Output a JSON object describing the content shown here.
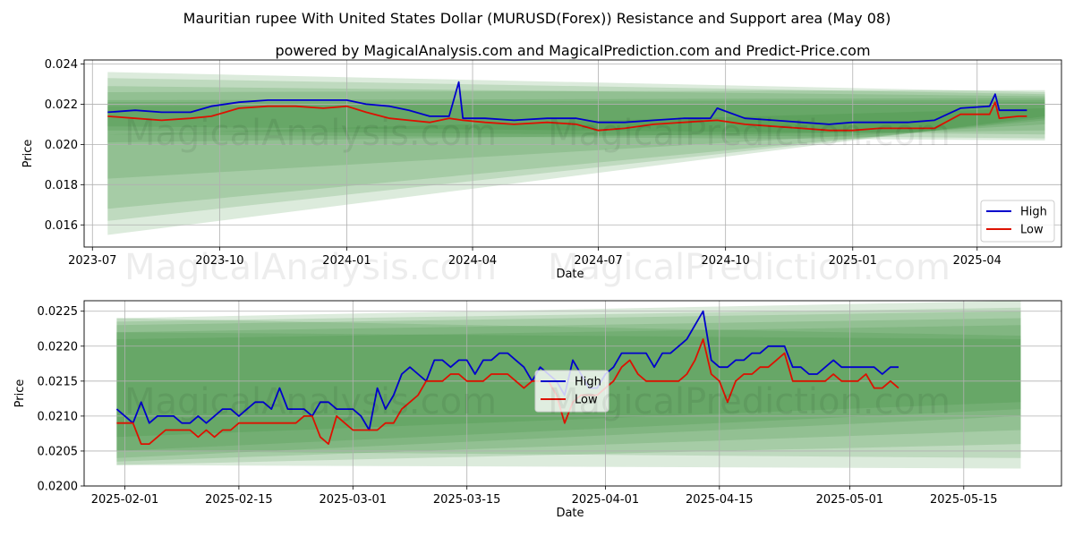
{
  "header": {
    "title": "Mauritian rupee With United States Dollar (MURUSD(Forex)) Resistance and Support area (May 08)",
    "subtitle": "powered by MagicalAnalysis.com and MagicalPrediction.com and Predict-Price.com"
  },
  "watermark": {
    "left": "MagicalAnalysis.com",
    "right": "MagicalPrediction.com"
  },
  "colors": {
    "high": "#0000cc",
    "low": "#dd1100",
    "band": "#2e8b2e",
    "grid": "#b0b0b0"
  },
  "chart_data": [
    {
      "type": "line",
      "xlabel": "Date",
      "ylabel": "Price",
      "x_range": [
        "2023-06-25",
        "2025-06-01"
      ],
      "ylim": [
        0.0149,
        0.0242
      ],
      "grid": true,
      "legend_position": "lower-right",
      "x_ticks": [
        "2023-07",
        "2023-10",
        "2024-01",
        "2024-04",
        "2024-07",
        "2024-10",
        "2025-01",
        "2025-04"
      ],
      "y_ticks": [
        "0.016",
        "0.018",
        "0.020",
        "0.022",
        "0.024"
      ],
      "bands": {
        "start": "2023-07-12",
        "end": "2025-05-20",
        "fans": [
          {
            "start": [
              0.0236,
              0.0205
            ],
            "end": [
              0.0226,
              0.0202
            ]
          },
          {
            "start": [
              0.0233,
              0.0207
            ],
            "end": [
              0.0225,
              0.0203
            ]
          },
          {
            "start": [
              0.0229,
              0.0209
            ],
            "end": [
              0.0224,
              0.0205
            ]
          },
          {
            "start": [
              0.0226,
              0.0201
            ],
            "end": [
              0.0227,
              0.0207
            ]
          },
          {
            "start": [
              0.0222,
              0.0183
            ],
            "end": [
              0.0223,
              0.021
            ]
          },
          {
            "start": [
              0.0221,
              0.0168
            ],
            "end": [
              0.0222,
              0.0212
            ]
          },
          {
            "start": [
              0.0219,
              0.0162
            ],
            "end": [
              0.0221,
              0.0213
            ]
          },
          {
            "start": [
              0.0205,
              0.0155
            ],
            "end": [
              0.0218,
              0.0214
            ]
          }
        ]
      },
      "series": [
        {
          "name": "High",
          "color": "#0000cc",
          "x": [
            "2023-07-12",
            "2023-08-01",
            "2023-08-20",
            "2023-09-10",
            "2023-09-25",
            "2023-10-15",
            "2023-11-05",
            "2023-11-25",
            "2023-12-15",
            "2024-01-01",
            "2024-01-15",
            "2024-02-01",
            "2024-02-15",
            "2024-03-01",
            "2024-03-15",
            "2024-03-22",
            "2024-03-25",
            "2024-04-10",
            "2024-05-01",
            "2024-05-25",
            "2024-06-15",
            "2024-07-01",
            "2024-07-20",
            "2024-08-10",
            "2024-09-01",
            "2024-09-20",
            "2024-09-25",
            "2024-10-15",
            "2024-11-05",
            "2024-11-25",
            "2024-12-15",
            "2025-01-01",
            "2025-01-20",
            "2025-02-10",
            "2025-03-01",
            "2025-03-20",
            "2025-04-10",
            "2025-04-14",
            "2025-04-17",
            "2025-05-01",
            "2025-05-07"
          ],
          "values": [
            0.0216,
            0.0217,
            0.0216,
            0.0216,
            0.0219,
            0.0221,
            0.0222,
            0.0222,
            0.0222,
            0.0222,
            0.022,
            0.0219,
            0.0217,
            0.0214,
            0.0214,
            0.0231,
            0.0213,
            0.0213,
            0.0212,
            0.0213,
            0.0213,
            0.0211,
            0.0211,
            0.0212,
            0.0213,
            0.0213,
            0.0218,
            0.0213,
            0.0212,
            0.0211,
            0.021,
            0.0211,
            0.0211,
            0.0211,
            0.0212,
            0.0218,
            0.0219,
            0.0225,
            0.0217,
            0.0217,
            0.0217
          ]
        },
        {
          "name": "Low",
          "color": "#dd1100",
          "x": [
            "2023-07-12",
            "2023-08-01",
            "2023-08-20",
            "2023-09-10",
            "2023-09-25",
            "2023-10-15",
            "2023-11-05",
            "2023-11-25",
            "2023-12-15",
            "2024-01-01",
            "2024-01-15",
            "2024-02-01",
            "2024-02-15",
            "2024-03-01",
            "2024-03-15",
            "2024-03-25",
            "2024-04-10",
            "2024-05-01",
            "2024-05-25",
            "2024-06-15",
            "2024-07-01",
            "2024-07-20",
            "2024-08-10",
            "2024-09-01",
            "2024-09-25",
            "2024-10-15",
            "2024-11-05",
            "2024-11-25",
            "2024-12-15",
            "2025-01-01",
            "2025-01-20",
            "2025-02-10",
            "2025-03-01",
            "2025-03-20",
            "2025-04-10",
            "2025-04-14",
            "2025-04-17",
            "2025-05-01",
            "2025-05-07"
          ],
          "values": [
            0.0214,
            0.0213,
            0.0212,
            0.0213,
            0.0214,
            0.0218,
            0.0219,
            0.0219,
            0.0218,
            0.0219,
            0.0216,
            0.0213,
            0.0212,
            0.0211,
            0.0213,
            0.0212,
            0.0211,
            0.021,
            0.0211,
            0.021,
            0.0207,
            0.0208,
            0.021,
            0.0211,
            0.0212,
            0.021,
            0.0209,
            0.0208,
            0.0207,
            0.0207,
            0.0208,
            0.0208,
            0.0208,
            0.0215,
            0.0215,
            0.0221,
            0.0213,
            0.0214,
            0.0214
          ]
        }
      ]
    },
    {
      "type": "line",
      "xlabel": "Date",
      "ylabel": "Price",
      "x_range": [
        "2025-01-27",
        "2025-05-27"
      ],
      "ylim": [
        0.02,
        0.02265
      ],
      "grid": true,
      "legend_position": "center",
      "x_ticks": [
        "2025-02-01",
        "2025-02-15",
        "2025-03-01",
        "2025-03-15",
        "2025-04-01",
        "2025-04-15",
        "2025-05-01",
        "2025-05-15"
      ],
      "y_ticks": [
        "0.0200",
        "0.0205",
        "0.0210",
        "0.0215",
        "0.0220",
        "0.0225"
      ],
      "bands": {
        "start": "2025-01-31",
        "end": "2025-05-22",
        "fans": [
          {
            "start": [
              0.0224,
              0.0203
            ],
            "end": [
              0.02265,
              0.0206
            ]
          },
          {
            "start": [
              0.02235,
              0.02035
            ],
            "end": [
              0.02255,
              0.0208
            ]
          },
          {
            "start": [
              0.0223,
              0.0204
            ],
            "end": [
              0.0225,
              0.021
            ]
          },
          {
            "start": [
              0.0222,
              0.0205
            ],
            "end": [
              0.0224,
              0.0211
            ]
          },
          {
            "start": [
              0.0221,
              0.0207
            ],
            "end": [
              0.0223,
              0.0212
            ]
          },
          {
            "start": [
              0.0224,
              0.0203
            ],
            "end": [
              0.02215,
              0.02025
            ]
          },
          {
            "start": [
              0.0222,
              0.0205
            ],
            "end": [
              0.0221,
              0.0204
            ]
          }
        ]
      },
      "series": [
        {
          "name": "High",
          "color": "#0000cc",
          "x": [
            "2025-01-31",
            "2025-02-02",
            "2025-02-03",
            "2025-02-04",
            "2025-02-05",
            "2025-02-06",
            "2025-02-07",
            "2025-02-08",
            "2025-02-09",
            "2025-02-10",
            "2025-02-11",
            "2025-02-12",
            "2025-02-13",
            "2025-02-14",
            "2025-02-15",
            "2025-02-16",
            "2025-02-17",
            "2025-02-18",
            "2025-02-19",
            "2025-02-20",
            "2025-02-21",
            "2025-02-22",
            "2025-02-23",
            "2025-02-24",
            "2025-02-25",
            "2025-02-26",
            "2025-02-27",
            "2025-02-28",
            "2025-03-01",
            "2025-03-02",
            "2025-03-03",
            "2025-03-04",
            "2025-03-05",
            "2025-03-06",
            "2025-03-07",
            "2025-03-08",
            "2025-03-09",
            "2025-03-10",
            "2025-03-11",
            "2025-03-12",
            "2025-03-13",
            "2025-03-14",
            "2025-03-15",
            "2025-03-16",
            "2025-03-17",
            "2025-03-18",
            "2025-03-19",
            "2025-03-20",
            "2025-03-21",
            "2025-03-22",
            "2025-03-23",
            "2025-03-24",
            "2025-03-25",
            "2025-03-26",
            "2025-03-27",
            "2025-03-28",
            "2025-03-29",
            "2025-03-30",
            "2025-03-31",
            "2025-04-01",
            "2025-04-02",
            "2025-04-03",
            "2025-04-04",
            "2025-04-05",
            "2025-04-06",
            "2025-04-07",
            "2025-04-08",
            "2025-04-09",
            "2025-04-10",
            "2025-04-11",
            "2025-04-12",
            "2025-04-13",
            "2025-04-14",
            "2025-04-15",
            "2025-04-16",
            "2025-04-17",
            "2025-04-18",
            "2025-04-19",
            "2025-04-20",
            "2025-04-21",
            "2025-04-22",
            "2025-04-23",
            "2025-04-24",
            "2025-04-25",
            "2025-04-26",
            "2025-04-27",
            "2025-04-28",
            "2025-04-29",
            "2025-04-30",
            "2025-05-01",
            "2025-05-02",
            "2025-05-03",
            "2025-05-04",
            "2025-05-05",
            "2025-05-06",
            "2025-05-07"
          ],
          "values": [
            0.0211,
            0.0209,
            0.0212,
            0.0209,
            0.021,
            0.021,
            0.021,
            0.0209,
            0.0209,
            0.021,
            0.0209,
            0.021,
            0.0211,
            0.0211,
            0.021,
            0.0211,
            0.0212,
            0.0212,
            0.0211,
            0.0214,
            0.0211,
            0.0211,
            0.0211,
            0.021,
            0.0212,
            0.0212,
            0.0211,
            0.0211,
            0.0211,
            0.021,
            0.0208,
            0.0214,
            0.0211,
            0.0213,
            0.0216,
            0.0217,
            0.0216,
            0.0215,
            0.0218,
            0.0218,
            0.0217,
            0.0218,
            0.0218,
            0.0216,
            0.0218,
            0.0218,
            0.0219,
            0.0219,
            0.0218,
            0.0217,
            0.0215,
            0.0217,
            0.0216,
            0.0215,
            0.0213,
            0.0218,
            0.0216,
            0.0214,
            0.0214,
            0.0216,
            0.0217,
            0.0219,
            0.0219,
            0.0219,
            0.0219,
            0.0217,
            0.0219,
            0.0219,
            0.022,
            0.0221,
            0.0223,
            0.0225,
            0.0218,
            0.0217,
            0.0217,
            0.0218,
            0.0218,
            0.0219,
            0.0219,
            0.022,
            0.022,
            0.022,
            0.0217,
            0.0217,
            0.0216,
            0.0216,
            0.0217,
            0.0218,
            0.0217,
            0.0217,
            0.0217,
            0.0217,
            0.0217,
            0.0216,
            0.0217,
            0.0217
          ]
        },
        {
          "name": "Low",
          "color": "#dd1100",
          "x": [
            "2025-01-31",
            "2025-02-02",
            "2025-02-03",
            "2025-02-04",
            "2025-02-05",
            "2025-02-06",
            "2025-02-07",
            "2025-02-08",
            "2025-02-09",
            "2025-02-10",
            "2025-02-11",
            "2025-02-12",
            "2025-02-13",
            "2025-02-14",
            "2025-02-15",
            "2025-02-16",
            "2025-02-17",
            "2025-02-18",
            "2025-02-19",
            "2025-02-20",
            "2025-02-21",
            "2025-02-22",
            "2025-02-23",
            "2025-02-24",
            "2025-02-25",
            "2025-02-26",
            "2025-02-27",
            "2025-02-28",
            "2025-03-01",
            "2025-03-02",
            "2025-03-03",
            "2025-03-04",
            "2025-03-05",
            "2025-03-06",
            "2025-03-07",
            "2025-03-08",
            "2025-03-09",
            "2025-03-10",
            "2025-03-11",
            "2025-03-12",
            "2025-03-13",
            "2025-03-14",
            "2025-03-15",
            "2025-03-16",
            "2025-03-17",
            "2025-03-18",
            "2025-03-19",
            "2025-03-20",
            "2025-03-21",
            "2025-03-22",
            "2025-03-23",
            "2025-03-24",
            "2025-03-25",
            "2025-03-26",
            "2025-03-27",
            "2025-03-28",
            "2025-03-29",
            "2025-03-30",
            "2025-03-31",
            "2025-04-01",
            "2025-04-02",
            "2025-04-03",
            "2025-04-04",
            "2025-04-05",
            "2025-04-06",
            "2025-04-07",
            "2025-04-08",
            "2025-04-09",
            "2025-04-10",
            "2025-04-11",
            "2025-04-12",
            "2025-04-13",
            "2025-04-14",
            "2025-04-15",
            "2025-04-16",
            "2025-04-17",
            "2025-04-18",
            "2025-04-19",
            "2025-04-20",
            "2025-04-21",
            "2025-04-22",
            "2025-04-23",
            "2025-04-24",
            "2025-04-25",
            "2025-04-26",
            "2025-04-27",
            "2025-04-28",
            "2025-04-29",
            "2025-04-30",
            "2025-05-01",
            "2025-05-02",
            "2025-05-03",
            "2025-05-04",
            "2025-05-05",
            "2025-05-06",
            "2025-05-07"
          ],
          "values": [
            0.0209,
            0.0209,
            0.0206,
            0.0206,
            0.0207,
            0.0208,
            0.0208,
            0.0208,
            0.0208,
            0.0207,
            0.0208,
            0.0207,
            0.0208,
            0.0208,
            0.0209,
            0.0209,
            0.0209,
            0.0209,
            0.0209,
            0.0209,
            0.0209,
            0.0209,
            0.021,
            0.021,
            0.0207,
            0.0206,
            0.021,
            0.0209,
            0.0208,
            0.0208,
            0.0208,
            0.0208,
            0.0209,
            0.0209,
            0.0211,
            0.0212,
            0.0213,
            0.0215,
            0.0215,
            0.0215,
            0.0216,
            0.0216,
            0.0215,
            0.0215,
            0.0215,
            0.0216,
            0.0216,
            0.0216,
            0.0215,
            0.0214,
            0.0215,
            0.0215,
            0.0215,
            0.0213,
            0.0209,
            0.0212,
            0.0213,
            0.0213,
            0.0213,
            0.0214,
            0.0215,
            0.0217,
            0.0218,
            0.0216,
            0.0215,
            0.0215,
            0.0215,
            0.0215,
            0.0215,
            0.0216,
            0.0218,
            0.0221,
            0.0216,
            0.0215,
            0.0212,
            0.0215,
            0.0216,
            0.0216,
            0.0217,
            0.0217,
            0.0218,
            0.0219,
            0.0215,
            0.0215,
            0.0215,
            0.0215,
            0.0215,
            0.0216,
            0.0215,
            0.0215,
            0.0215,
            0.0216,
            0.0214,
            0.0214,
            0.0215,
            0.0214
          ]
        }
      ]
    }
  ]
}
